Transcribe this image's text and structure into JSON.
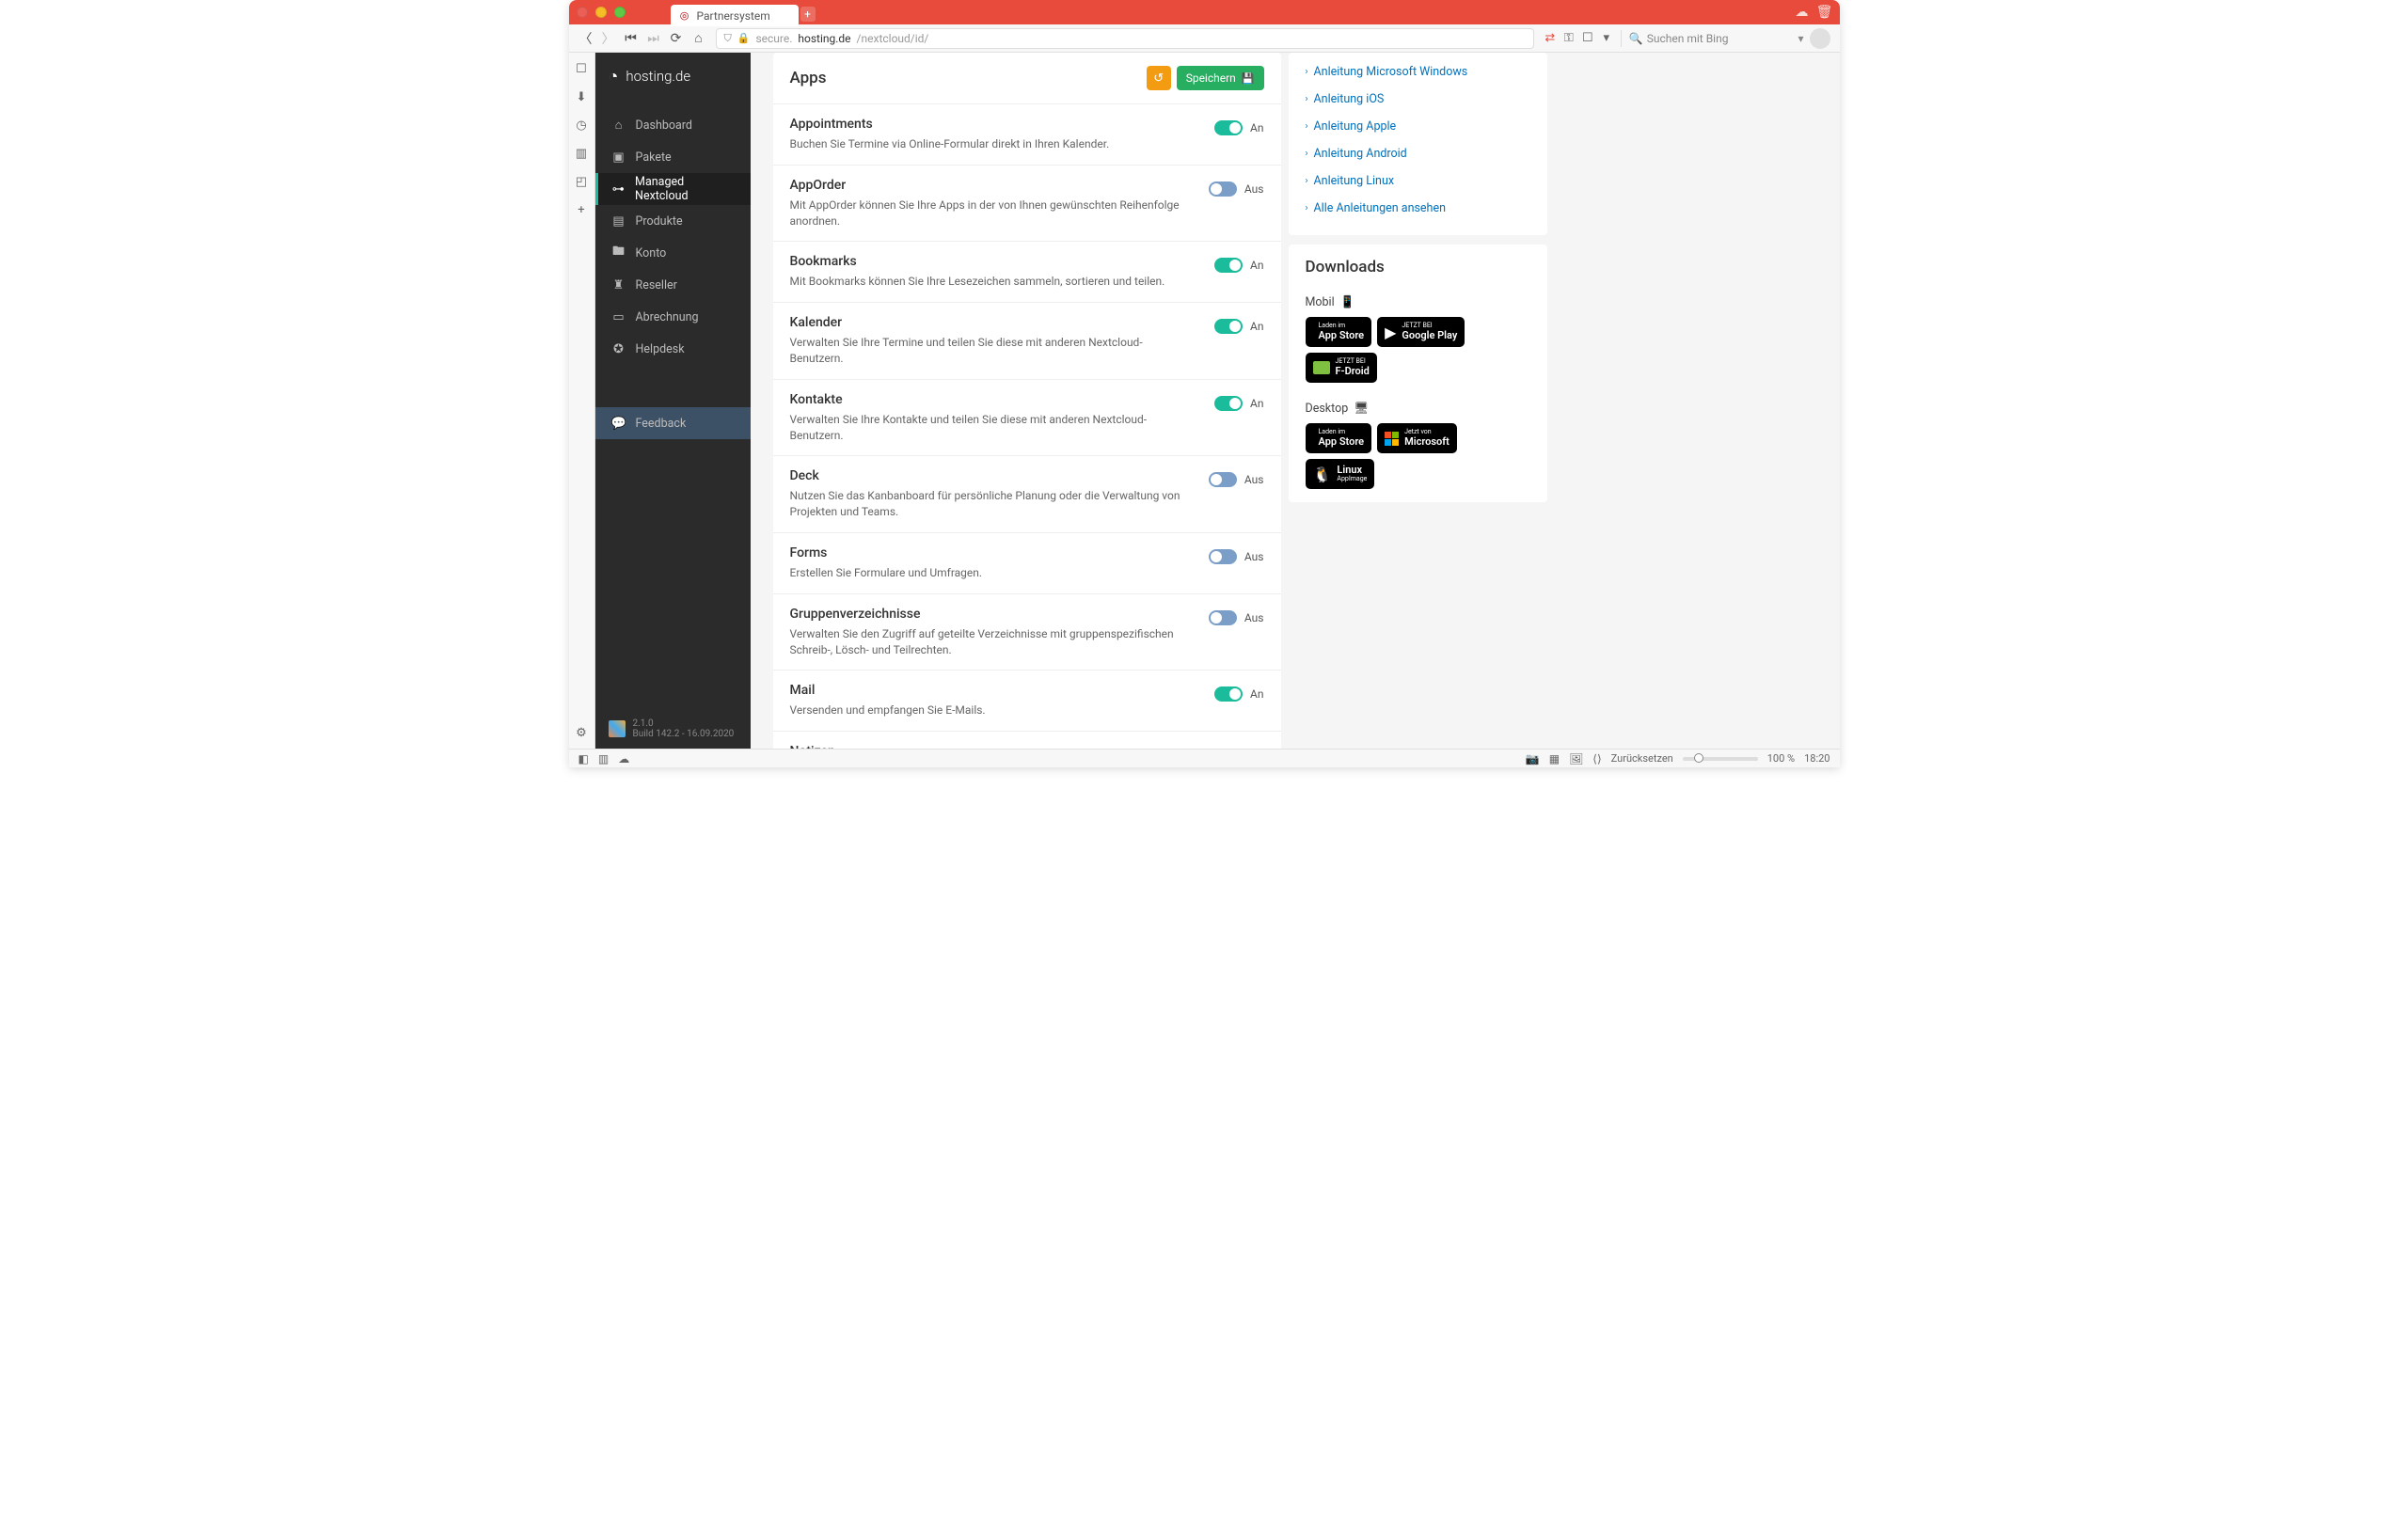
{
  "browser": {
    "tab_title": "Partnersystem",
    "url_secure_prefix": "secure.",
    "url_host": "hosting.de",
    "url_path": "/nextcloud/id/",
    "search_placeholder": "Suchen mit Bing"
  },
  "sidebar": {
    "brand": "hosting.de",
    "items": [
      {
        "icon": "⌂",
        "label": "Dashboard"
      },
      {
        "icon": "▣",
        "label": "Pakete"
      },
      {
        "icon": "⊶",
        "label": "Managed Nextcloud"
      },
      {
        "icon": "▤",
        "label": "Produkte"
      },
      {
        "icon": "🖿",
        "label": "Konto"
      },
      {
        "icon": "♜",
        "label": "Reseller"
      },
      {
        "icon": "▭",
        "label": "Abrechnung"
      },
      {
        "icon": "✪",
        "label": "Helpdesk"
      }
    ],
    "feedback_label": "Feedback",
    "version": "2.1.0",
    "build": "Build 142.2 - 16.09.2020"
  },
  "apps_panel": {
    "title": "Apps",
    "save_label": "Speichern",
    "items": [
      {
        "name": "Appointments",
        "desc": "Buchen Sie Termine via Online-Formular direkt in Ihren Kalender.",
        "state": "on",
        "state_label": "An"
      },
      {
        "name": "AppOrder",
        "desc": "Mit AppOrder können Sie Ihre Apps in der von Ihnen gewünschten Reihenfolge anordnen.",
        "state": "off",
        "state_label": "Aus"
      },
      {
        "name": "Bookmarks",
        "desc": "Mit Bookmarks können Sie Ihre Lesezeichen sammeln, sortieren und teilen.",
        "state": "on",
        "state_label": "An"
      },
      {
        "name": "Kalender",
        "desc": "Verwalten Sie Ihre Termine und teilen Sie diese mit anderen Nextcloud-Benutzern.",
        "state": "on",
        "state_label": "An"
      },
      {
        "name": "Kontakte",
        "desc": "Verwalten Sie Ihre Kontakte und teilen Sie diese mit anderen Nextcloud-Benutzern.",
        "state": "on",
        "state_label": "An"
      },
      {
        "name": "Deck",
        "desc": "Nutzen Sie das Kanbanboard für persönliche Planung oder die Verwaltung von Projekten und Teams.",
        "state": "off",
        "state_label": "Aus"
      },
      {
        "name": "Forms",
        "desc": "Erstellen Sie Formulare und Umfragen.",
        "state": "off",
        "state_label": "Aus"
      },
      {
        "name": "Gruppenverzeichnisse",
        "desc": "Verwalten Sie den Zugriff auf geteilte Verzeichnisse mit gruppenspezifischen Schreib-, Lösch- und Teilrechten.",
        "state": "off",
        "state_label": "Aus"
      },
      {
        "name": "Mail",
        "desc": "Versenden und empfangen Sie E-Mails.",
        "state": "on",
        "state_label": "An"
      },
      {
        "name": "Notizen",
        "desc": "",
        "state": "",
        "state_label": ""
      }
    ]
  },
  "guides": {
    "items": [
      "Anleitung Microsoft Windows",
      "Anleitung iOS",
      "Anleitung Apple",
      "Anleitung Android",
      "Anleitung Linux",
      "Alle Anleitungen ansehen"
    ]
  },
  "downloads": {
    "title": "Downloads",
    "mobile_label": "Mobil",
    "desktop_label": "Desktop",
    "appstore_small": "Laden im",
    "appstore_big": "App Store",
    "play_small": "JETZT BEI",
    "play_big": "Google Play",
    "fdroid_small": "JETZT BEI",
    "fdroid_big": "F-Droid",
    "msstore_small": "Jetzt von",
    "msstore_big": "Microsoft",
    "linux_small": "Linux",
    "linux_big": "AppImage"
  },
  "statusbar": {
    "reset": "Zurücksetzen",
    "zoom": "100 %",
    "time": "18:20"
  }
}
